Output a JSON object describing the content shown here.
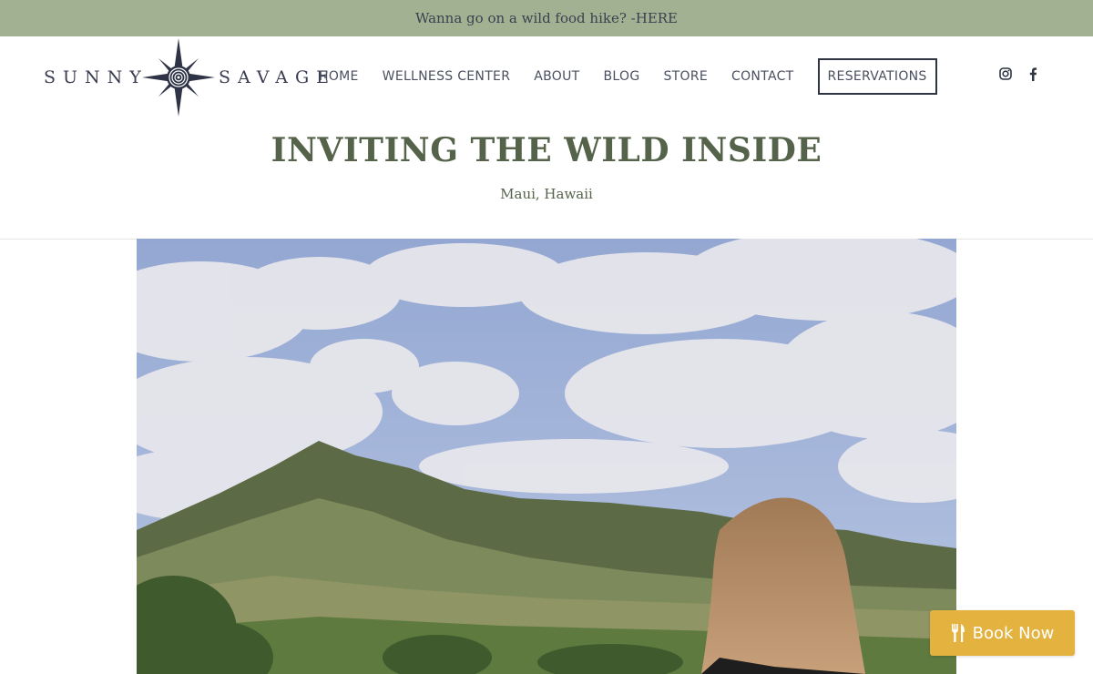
{
  "announcement": {
    "text": "Wanna go on a wild food hike? - ",
    "link_label": "HERE"
  },
  "brand": {
    "word1": "SUNNY",
    "word2": "SAVAGE",
    "color": "#3a3d52"
  },
  "nav": {
    "items": [
      {
        "label": "HOME"
      },
      {
        "label": "WELLNESS CENTER"
      },
      {
        "label": "ABOUT"
      },
      {
        "label": "BLOG"
      },
      {
        "label": "STORE"
      },
      {
        "label": "CONTACT"
      }
    ],
    "reserve_label": "RESERVATIONS"
  },
  "social": {
    "icons": [
      "instagram-icon",
      "facebook-icon"
    ]
  },
  "hero": {
    "title": "INVITING THE WILD INSIDE",
    "subtitle": "Maui, Hawaii"
  },
  "book_button": {
    "label": "Book Now",
    "icon": "fork-knife-icon",
    "color": "#e3b23f"
  },
  "colors": {
    "announcement_bar": "#a3b193",
    "title_green": "#55634a"
  }
}
